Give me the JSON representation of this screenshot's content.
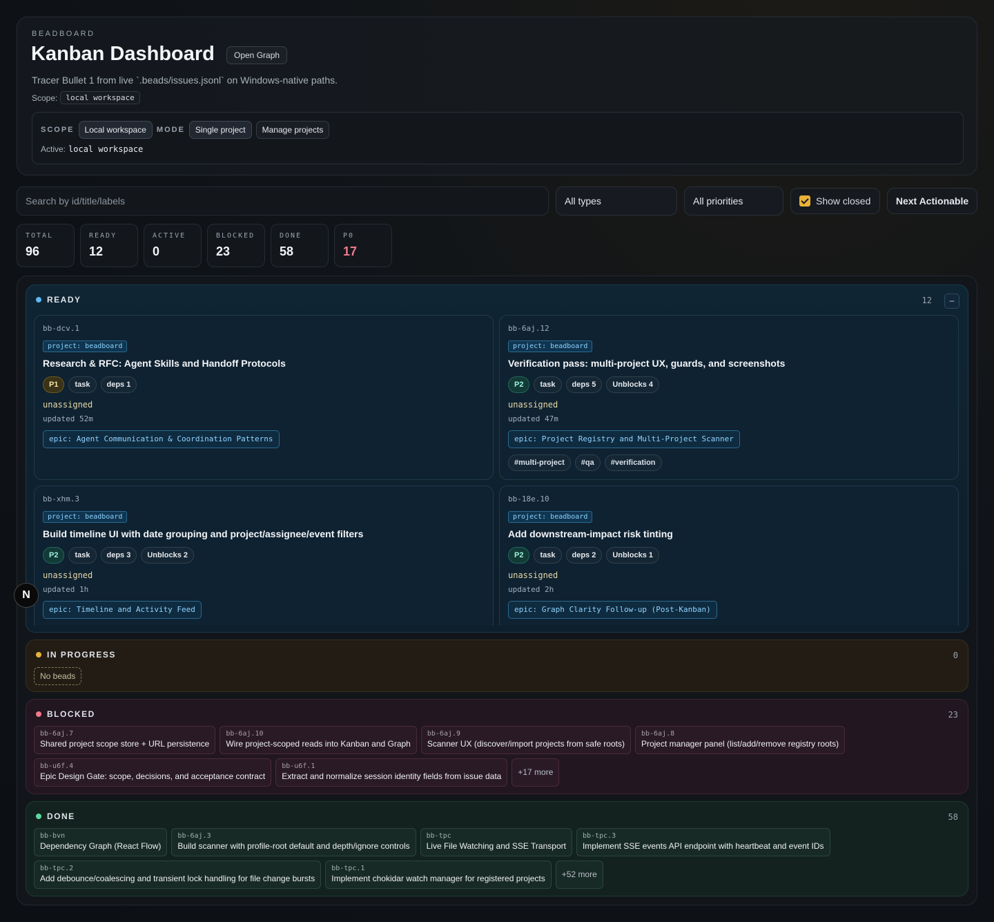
{
  "header": {
    "eyebrow": "BEADBOARD",
    "title": "Kanban Dashboard",
    "open_graph": "Open Graph",
    "subtitle": "Tracer Bullet 1 from live `.beads/issues.jsonl` on Windows-native paths.",
    "scope_label": "Scope:",
    "scope_value": "local workspace",
    "scope_caps": "SCOPE",
    "scope_option": "Local workspace",
    "mode_caps": "MODE",
    "mode_option": "Single project",
    "manage_projects": "Manage projects",
    "active_label": "Active:",
    "active_value": "local workspace"
  },
  "filters": {
    "search_placeholder": "Search by id/title/labels",
    "types": "All types",
    "priorities": "All priorities",
    "show_closed": "Show closed",
    "show_closed_checked": true,
    "next_actionable": "Next Actionable"
  },
  "stats": [
    {
      "label": "TOTAL",
      "value": "96"
    },
    {
      "label": "READY",
      "value": "12"
    },
    {
      "label": "ACTIVE",
      "value": "0"
    },
    {
      "label": "BLOCKED",
      "value": "23"
    },
    {
      "label": "DONE",
      "value": "58"
    },
    {
      "label": "P0",
      "value": "17"
    }
  ],
  "columns": {
    "ready": {
      "title": "READY",
      "count": "12",
      "collapse": "–",
      "dot_color": "#5fb8f0",
      "cards": [
        {
          "id": "bb-dcv.1",
          "project": "project: beadboard",
          "title": "Research & RFC: Agent Skills and Handoff Protocols",
          "priority": "P1",
          "type": "task",
          "deps": "deps 1",
          "unblocks": "",
          "assignee": "unassigned",
          "updated": "updated 52m",
          "epic": "epic: Agent Communication & Coordination Patterns",
          "labels": []
        },
        {
          "id": "bb-6aj.12",
          "project": "project: beadboard",
          "title": "Verification pass: multi-project UX, guards, and screenshots",
          "priority": "P2",
          "type": "task",
          "deps": "deps 5",
          "unblocks": "Unblocks 4",
          "assignee": "unassigned",
          "updated": "updated 47m",
          "epic": "epic: Project Registry and Multi-Project Scanner",
          "labels": [
            "#multi-project",
            "#qa",
            "#verification"
          ]
        },
        {
          "id": "bb-xhm.3",
          "project": "project: beadboard",
          "title": "Build timeline UI with date grouping and project/assignee/event filters",
          "priority": "P2",
          "type": "task",
          "deps": "deps 3",
          "unblocks": "Unblocks 2",
          "assignee": "unassigned",
          "updated": "updated 1h",
          "epic": "epic: Timeline and Activity Feed",
          "labels": []
        },
        {
          "id": "bb-18e.10",
          "project": "project: beadboard",
          "title": "Add downstream-impact risk tinting",
          "priority": "P2",
          "type": "task",
          "deps": "deps 2",
          "unblocks": "Unblocks 1",
          "assignee": "unassigned",
          "updated": "updated 2h",
          "epic": "epic: Graph Clarity Follow-up (Post-Kanban)",
          "labels": []
        }
      ]
    },
    "in_progress": {
      "title": "IN PROGRESS",
      "count": "0",
      "dot_color": "#e8b23a",
      "empty": "No beads"
    },
    "blocked": {
      "title": "BLOCKED",
      "count": "23",
      "dot_color": "#f07a8a",
      "items": [
        {
          "id": "bb-6aj.7",
          "title": "Shared project scope store + URL persistence"
        },
        {
          "id": "bb-6aj.10",
          "title": "Wire project-scoped reads into Kanban and Graph"
        },
        {
          "id": "bb-6aj.9",
          "title": "Scanner UX (discover/import projects from safe roots)"
        },
        {
          "id": "bb-6aj.8",
          "title": "Project manager panel (list/add/remove registry roots)"
        },
        {
          "id": "bb-u6f.4",
          "title": "Epic Design Gate: scope, decisions, and acceptance contract"
        },
        {
          "id": "bb-u6f.1",
          "title": "Extract and normalize session identity fields from issue data"
        }
      ],
      "more": "+17 more"
    },
    "done": {
      "title": "DONE",
      "count": "58",
      "dot_color": "#5fd6a0",
      "items": [
        {
          "id": "bb-bvn",
          "title": "Dependency Graph (React Flow)"
        },
        {
          "id": "bb-6aj.3",
          "title": "Build scanner with profile-root default and depth/ignore controls"
        },
        {
          "id": "bb-tpc",
          "title": "Live File Watching and SSE Transport"
        },
        {
          "id": "bb-tpc.3",
          "title": "Implement SSE events API endpoint with heartbeat and event IDs"
        },
        {
          "id": "bb-tpc.2",
          "title": "Add debounce/coalescing and transient lock handling for file change bursts"
        },
        {
          "id": "bb-tpc.1",
          "title": "Implement chokidar watch manager for registered projects"
        }
      ],
      "more": "+52 more"
    }
  },
  "badge": "N"
}
